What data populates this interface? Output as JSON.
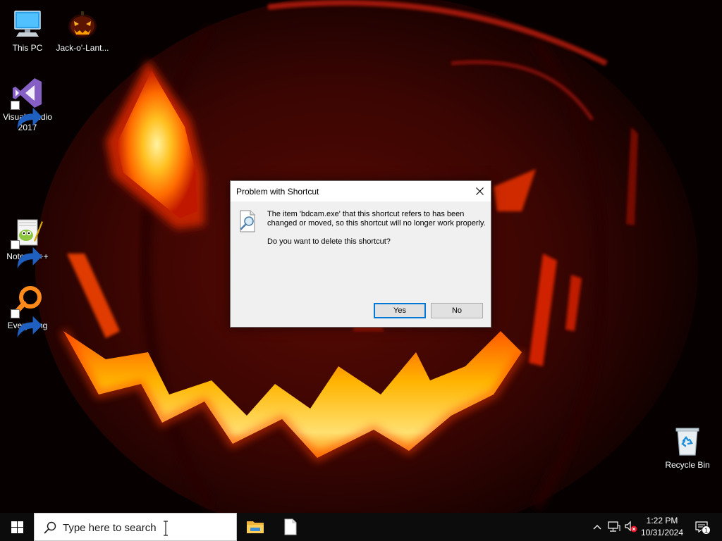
{
  "desktop": {
    "icons": [
      {
        "id": "this-pc",
        "label": "This PC",
        "icon": "computer-icon"
      },
      {
        "id": "jack-o-lantern",
        "label": "Jack-o'-Lant...",
        "icon": "pumpkin-icon"
      },
      {
        "id": "visual-studio",
        "label": "Visual Studio 2017",
        "icon": "visual-studio-icon"
      },
      {
        "id": "notepad-plus-plus",
        "label": "Notepad++",
        "icon": "notepad-plus-plus-icon"
      },
      {
        "id": "everything",
        "label": "Everything",
        "icon": "everything-search-icon"
      },
      {
        "id": "recycle-bin",
        "label": "Recycle Bin",
        "icon": "recycle-bin-icon"
      }
    ]
  },
  "dialog": {
    "title": "Problem with Shortcut",
    "close_label": "Close",
    "message_line1": "The item 'bdcam.exe' that this shortcut refers to has been",
    "message_line2": "changed or moved, so this shortcut will no longer work properly.",
    "question": "Do you want to delete this shortcut?",
    "yes_label": "Yes",
    "no_label": "No",
    "default_button": "Yes"
  },
  "taskbar": {
    "search_placeholder": "Type here to search",
    "pinned_apps": [
      "file-explorer-icon",
      "blank-document-icon"
    ],
    "tray": {
      "icons": [
        "chevron-up-icon",
        "network-icon",
        "volume-muted-icon"
      ],
      "time": "1:22 PM",
      "date": "10/31/2024",
      "notification_count": "1"
    }
  },
  "colors": {
    "accent": "#0078d7",
    "taskbar": "#0c0c0c",
    "dialog_background": "#f0f0f0"
  }
}
